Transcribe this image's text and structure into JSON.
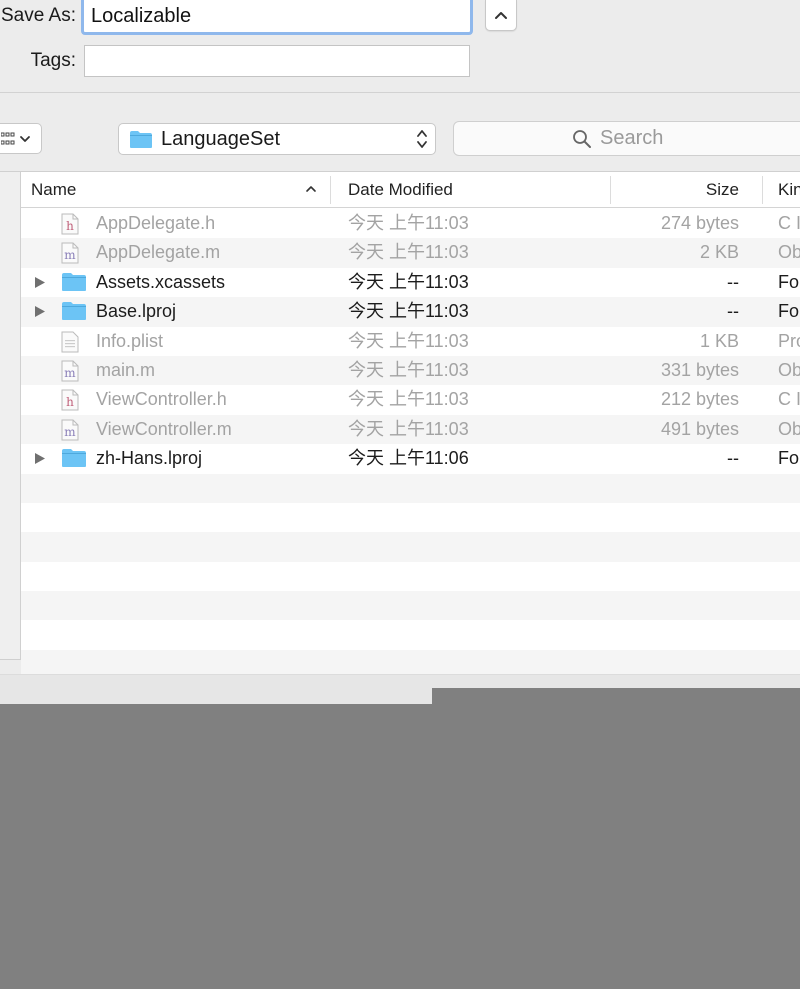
{
  "save_as": {
    "label": "Save As:",
    "value": "Localizable"
  },
  "tags": {
    "label": "Tags:",
    "value": ""
  },
  "location": {
    "name": "LanguageSet"
  },
  "search": {
    "placeholder": "Search"
  },
  "columns": {
    "name": "Name",
    "date": "Date Modified",
    "size": "Size",
    "kind": "Kin"
  },
  "files": [
    {
      "name": "AppDelegate.h",
      "date": "今天 上午11:03",
      "size": "274 bytes",
      "kind": "C I",
      "type": "h",
      "enabled": false,
      "folder": false
    },
    {
      "name": "AppDelegate.m",
      "date": "今天 上午11:03",
      "size": "2 KB",
      "kind": "Ob",
      "type": "m",
      "enabled": false,
      "folder": false
    },
    {
      "name": "Assets.xcassets",
      "date": "今天 上午11:03",
      "size": "--",
      "kind": "Fo",
      "type": "folder",
      "enabled": true,
      "folder": true
    },
    {
      "name": "Base.lproj",
      "date": "今天 上午11:03",
      "size": "--",
      "kind": "Fo",
      "type": "folder",
      "enabled": true,
      "folder": true
    },
    {
      "name": "Info.plist",
      "date": "今天 上午11:03",
      "size": "1 KB",
      "kind": "Pro",
      "type": "plist",
      "enabled": false,
      "folder": false
    },
    {
      "name": "main.m",
      "date": "今天 上午11:03",
      "size": "331 bytes",
      "kind": "Ob",
      "type": "m",
      "enabled": false,
      "folder": false
    },
    {
      "name": "ViewController.h",
      "date": "今天 上午11:03",
      "size": "212 bytes",
      "kind": "C I",
      "type": "h",
      "enabled": false,
      "folder": false
    },
    {
      "name": "ViewController.m",
      "date": "今天 上午11:03",
      "size": "491 bytes",
      "kind": "Ob",
      "type": "m",
      "enabled": false,
      "folder": false
    },
    {
      "name": "zh-Hans.lproj",
      "date": "今天 上午11:06",
      "size": "--",
      "kind": "Fo",
      "type": "folder",
      "enabled": true,
      "folder": true
    }
  ],
  "colors": {
    "folder": "#6cc4f5",
    "focus_ring": "#8fb8ec",
    "dim_text": "#a3a3a3"
  }
}
